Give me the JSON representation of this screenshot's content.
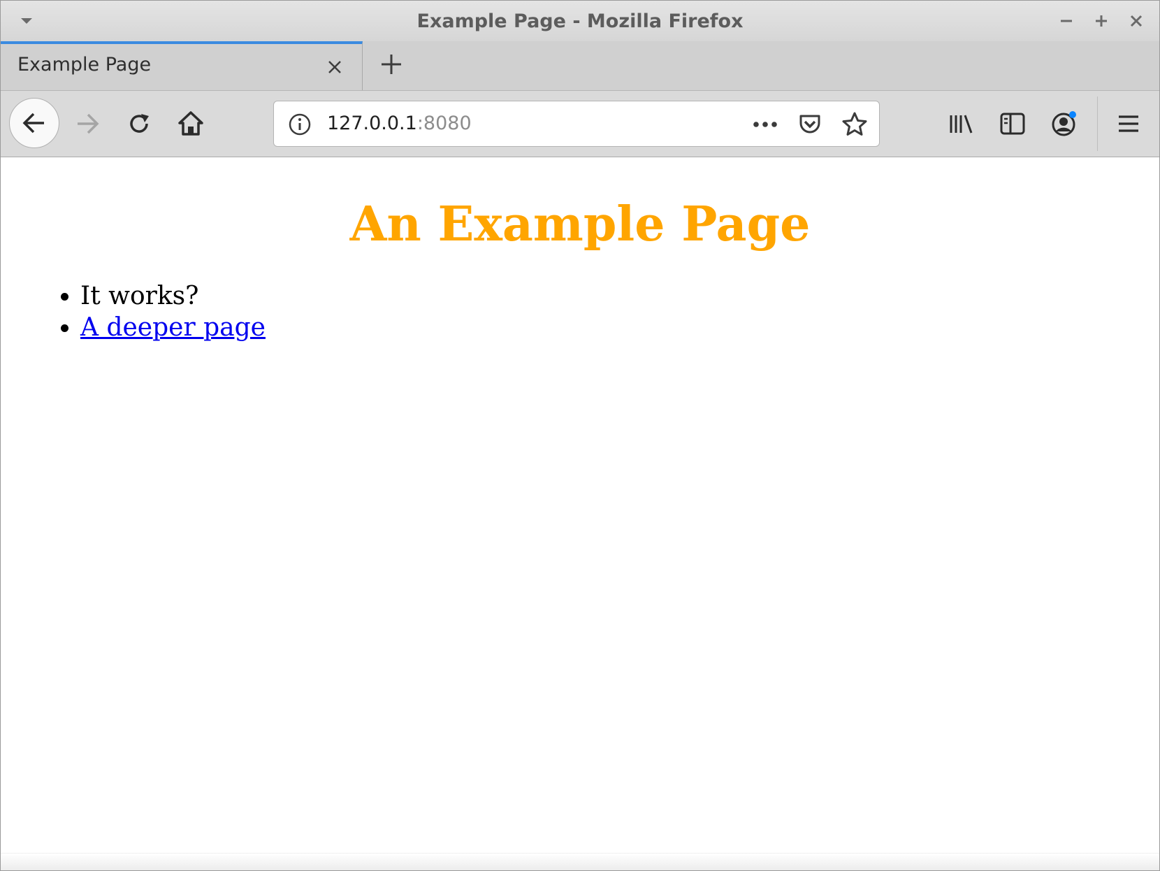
{
  "window": {
    "title": "Example Page - Mozilla Firefox"
  },
  "tabs": [
    {
      "label": "Example Page",
      "active": true
    }
  ],
  "toolbar": {
    "url_host": "127.0.0.1",
    "url_port": ":8080"
  },
  "page": {
    "heading": "An Example Page",
    "heading_color": "#ffa500",
    "items": [
      {
        "text": "It works?",
        "link": false
      },
      {
        "text": "A deeper page",
        "link": true
      }
    ],
    "link_color": "#0000ee"
  },
  "icons": {
    "titlebar": [
      "window-menu-icon",
      "minimize-icon",
      "maximize-icon",
      "close-window-icon"
    ],
    "nav": [
      "back-arrow-icon",
      "forward-arrow-icon",
      "reload-icon",
      "home-icon"
    ],
    "urlbar": [
      "info-icon",
      "page-actions-icon",
      "pocket-icon",
      "bookmark-star-icon"
    ],
    "right": [
      "library-icon",
      "sidebar-icon",
      "account-icon",
      "hamburger-menu-icon"
    ]
  }
}
